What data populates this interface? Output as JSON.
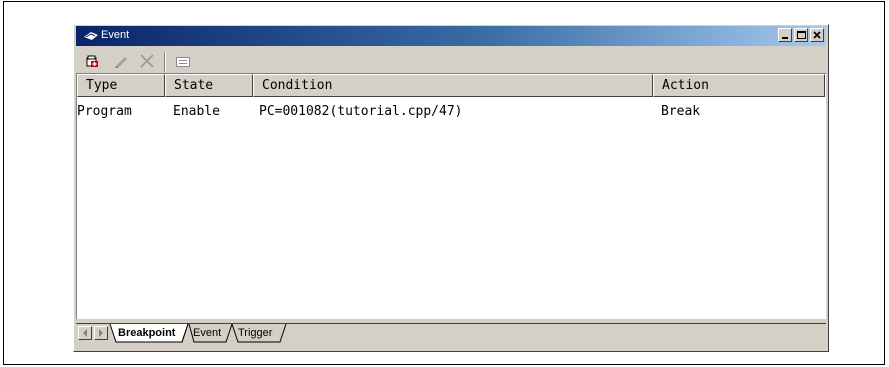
{
  "window": {
    "title": "Event"
  },
  "toolbar": {
    "icons": [
      "new-event-icon",
      "edit-icon",
      "delete-icon",
      "properties-icon"
    ]
  },
  "table": {
    "columns": [
      "Type",
      "State",
      "Condition",
      "Action"
    ],
    "rows": [
      {
        "type": "Program",
        "state": "Enable",
        "condition": "PC=001082(tutorial.cpp/47)",
        "action": "Break"
      }
    ]
  },
  "tabs": [
    {
      "label": "Breakpoint",
      "active": true
    },
    {
      "label": "Event",
      "active": false
    },
    {
      "label": "Trigger",
      "active": false
    }
  ],
  "colors": {
    "title_start": "#0a246a",
    "title_end": "#a6caf0",
    "face": "#d4d0c8"
  }
}
